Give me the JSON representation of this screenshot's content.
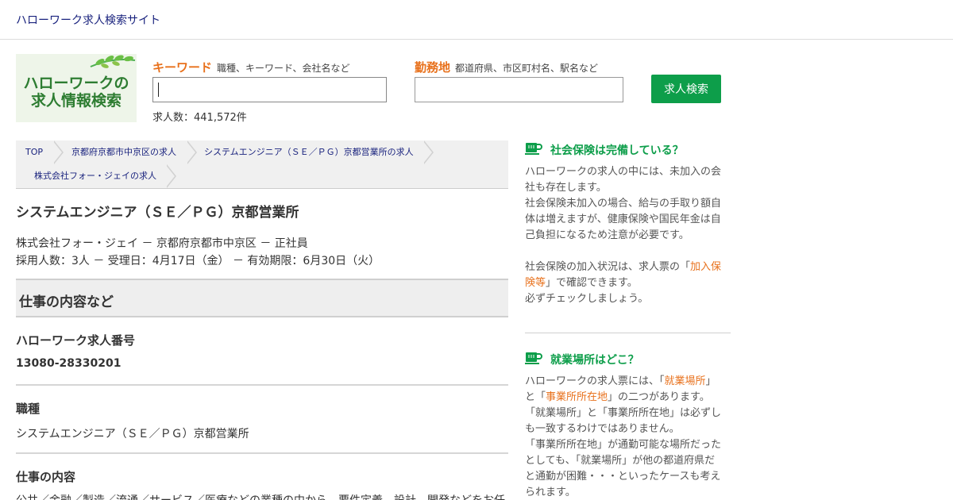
{
  "header": {
    "site_title": "ハローワーク求人検索サイト"
  },
  "logo": {
    "line1": "ハローワークの",
    "line2": "求人情報検索"
  },
  "search": {
    "keyword_label": "キーワード",
    "keyword_hint": "職種、キーワード、会社名など",
    "keyword_value": "",
    "location_label": "勤務地",
    "location_hint": "都道府県、市区町村名、駅名など",
    "location_value": "",
    "button_label": "求人検索",
    "count_text": "求人数：441,572件"
  },
  "breadcrumb": [
    "TOP",
    "京都府京都市中京区の求人",
    "システムエンジニア（ＳＥ／ＰＧ）京都営業所の求人",
    "株式会社フォー・ジェイの求人"
  ],
  "job": {
    "title": "システムエンジニア（ＳＥ／ＰＧ）京都営業所",
    "meta_line1": "株式会社フォー・ジェイ － 京都府京都市中京区 － 正社員",
    "meta_line2": "採用人数：3人 － 受理日：4月17日（金） － 有効期限：6月30日（火）"
  },
  "section": {
    "title": "仕事の内容など"
  },
  "fields": {
    "number_label": "ハローワーク求人番号",
    "number_value": "13080-28330201",
    "type_label": "職種",
    "type_value": "システムエンジニア（ＳＥ／ＰＧ）京都営業所",
    "content_label": "仕事の内容",
    "content_value": "公共／金融／製造／流通／サービス／医療などの業種の中から、要件定義、設計、開発などをお任"
  },
  "aside": {
    "insurance": {
      "title": "社会保険は完備している？",
      "p1_line1": "ハローワークの求人の中には、未加入の会",
      "p1_line2": "社も存在します。",
      "p1_line3": "社会保険未加入の場合、給与の手取り額自",
      "p1_line4": "体は増えますが、健康保険や国民年金は自",
      "p1_line5": "己負担になるため注意が必要です。",
      "p2_line1_a": "社会保険の加入状況は、求人票の「",
      "p2_line1_hl": "加入保",
      "p2_line2_hl": "険等",
      "p2_line2_b": "」で確認できます。",
      "p2_line3": "必ずチェックしましょう。"
    },
    "location": {
      "title": "就業場所はどこ？",
      "l1_a": "ハローワークの求人票には、「",
      "l1_hl": "就業場所",
      "l1_b": "」",
      "l2_a": "と「",
      "l2_hl": "事業所所在地",
      "l2_b": "」の二つがあります。",
      "l3": "「就業場所」と「事業所所在地」は必ずし",
      "l4": "も一致するわけではありません。",
      "l5": "「事業所所在地」が通勤可能な場所だった",
      "l6": "としても、「就業場所」が他の都道府県だ",
      "l7": "と通勤が困難・・・といったケースも考え",
      "l8": "られます。"
    }
  }
}
